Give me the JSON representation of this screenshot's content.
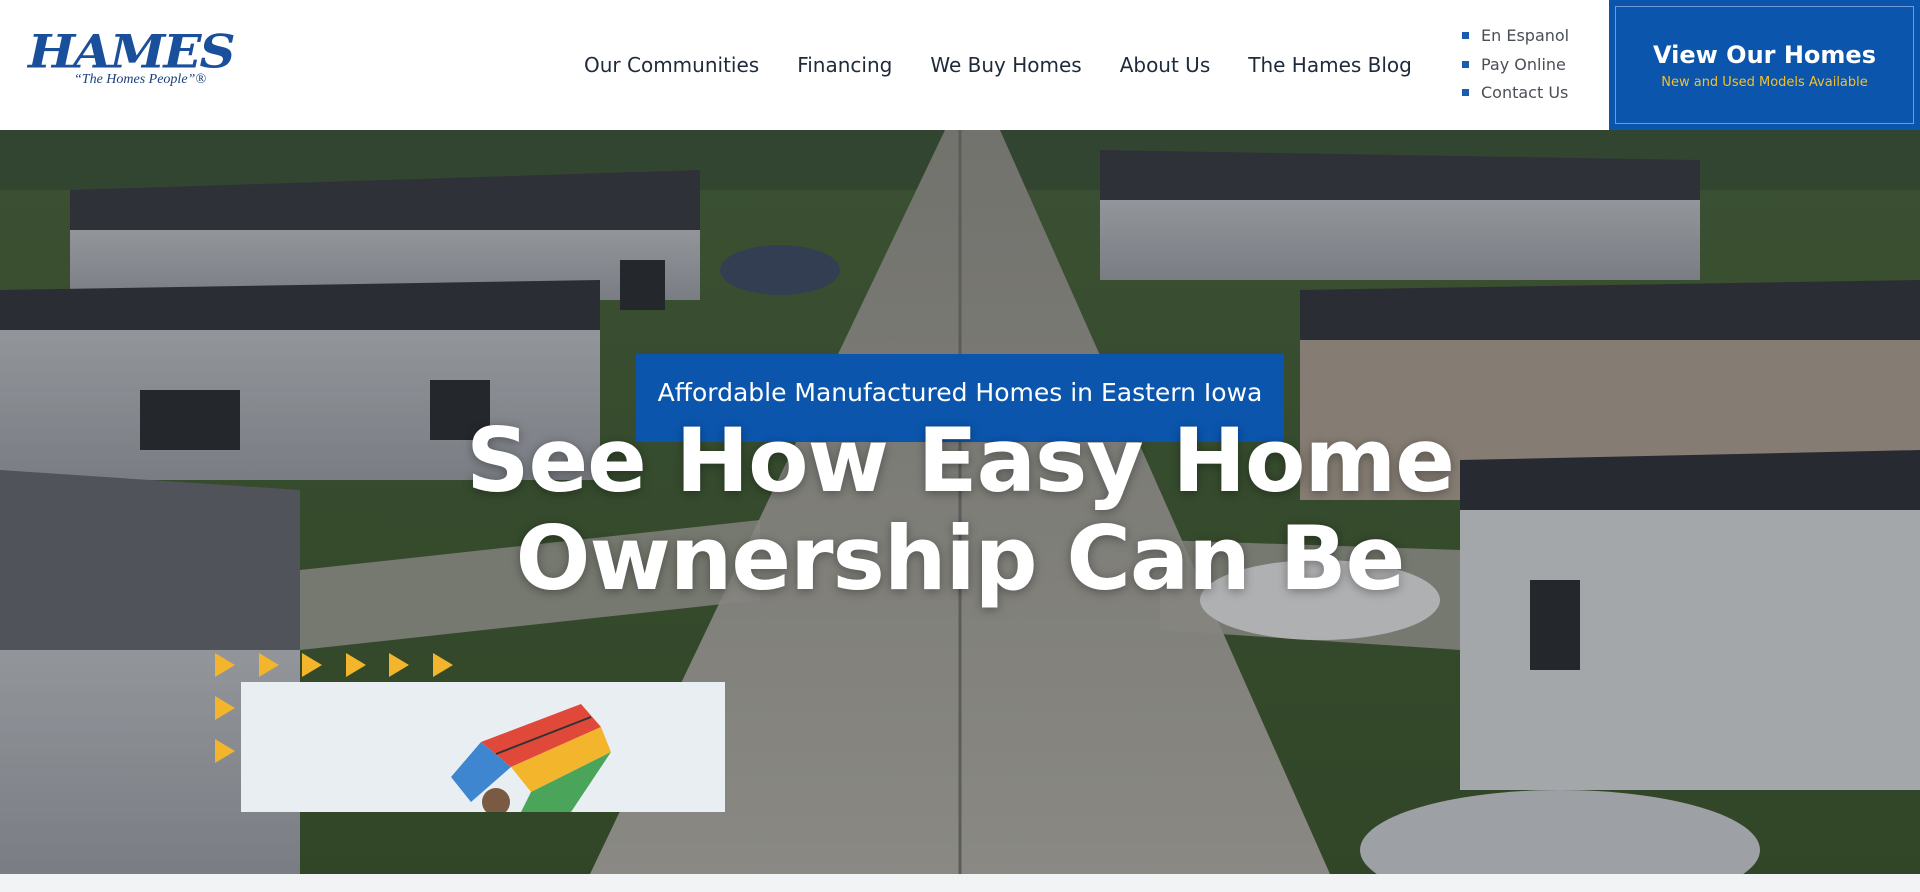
{
  "logo": {
    "name": "HAMES",
    "tagline": "“The Homes People”®"
  },
  "nav": {
    "items": [
      {
        "label": "Our Communities"
      },
      {
        "label": "Financing"
      },
      {
        "label": "We Buy Homes"
      },
      {
        "label": "About Us"
      },
      {
        "label": "The Hames Blog"
      }
    ]
  },
  "utility_links": [
    {
      "label": "En Espanol"
    },
    {
      "label": "Pay Online"
    },
    {
      "label": "Contact Us"
    }
  ],
  "cta": {
    "title": "View Our Homes",
    "subtitle": "New and Used Models Available"
  },
  "hero": {
    "subtitle": "Affordable Manufactured Homes in Eastern Iowa",
    "headline_line1": "See How Easy Home",
    "headline_line2": "Ownership Can Be"
  },
  "icons": {
    "bullet": "square-bullet-icon",
    "decoration": "triangle-arrow-icon"
  },
  "colors": {
    "brand_blue": "#0b55ad",
    "accent_yellow": "#f2b52c",
    "nav_text": "#1f2a3a"
  }
}
